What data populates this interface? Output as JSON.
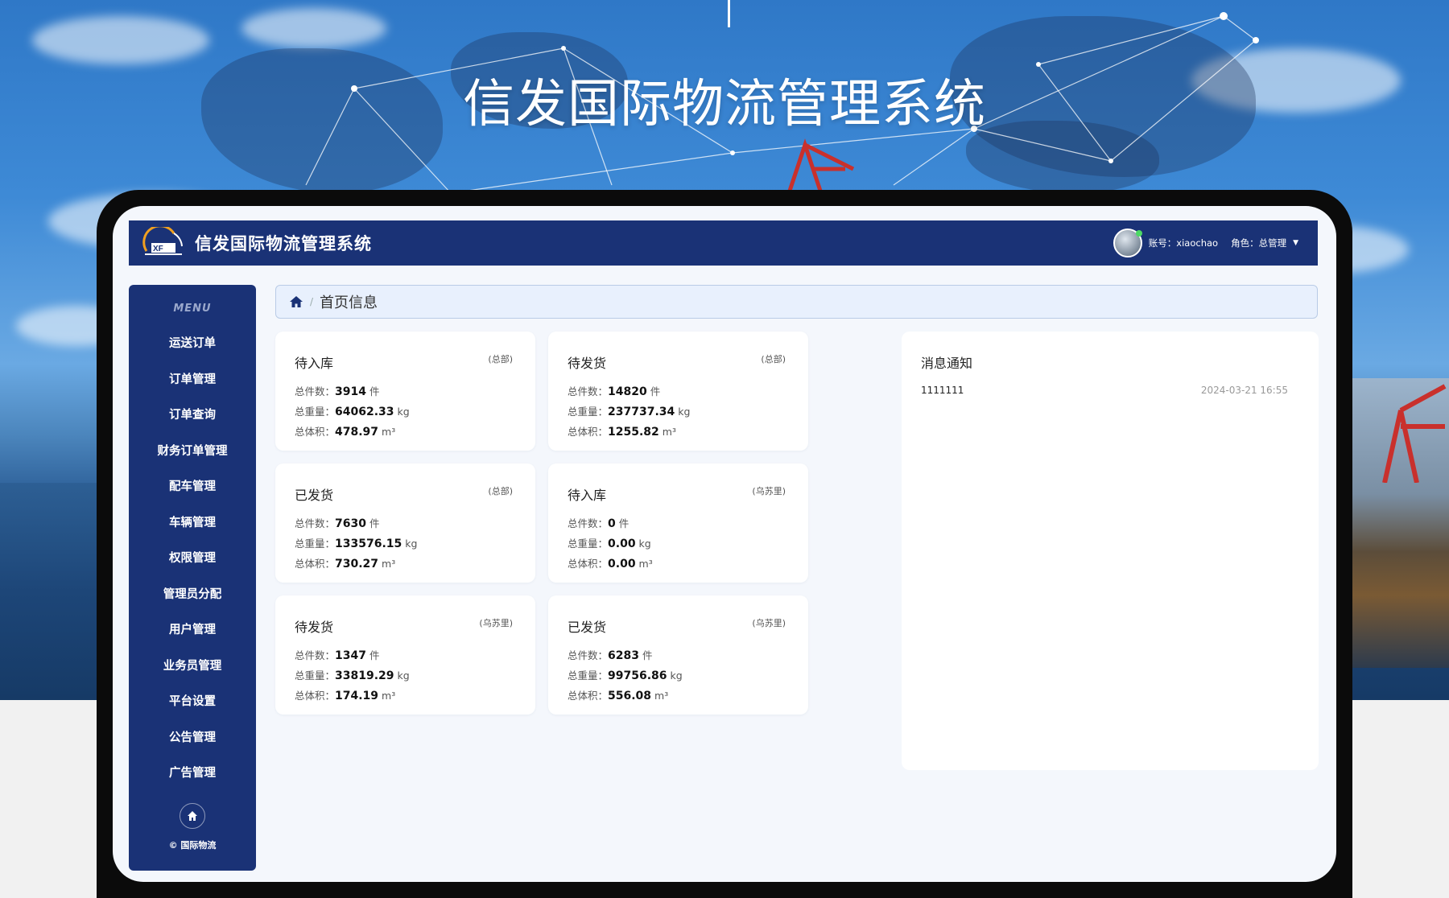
{
  "hero": {
    "title": "信发国际物流管理系统"
  },
  "header": {
    "app_name": "信发国际物流管理系统",
    "account_label": "账号：",
    "account": "xiaochao",
    "role_label": "角色：",
    "role": "总管理"
  },
  "sidebar": {
    "menu_title": "MENU",
    "items": [
      {
        "label": "运送订单"
      },
      {
        "label": "订单管理"
      },
      {
        "label": "订单查询"
      },
      {
        "label": "财务订单管理"
      },
      {
        "label": "配车管理"
      },
      {
        "label": "车辆管理"
      },
      {
        "label": "权限管理"
      },
      {
        "label": "管理员分配"
      },
      {
        "label": "用户管理"
      },
      {
        "label": "业务员管理"
      },
      {
        "label": "平台设置"
      },
      {
        "label": "公告管理"
      },
      {
        "label": "广告管理"
      }
    ],
    "copyright": "© 国际物流"
  },
  "breadcrumb": {
    "current": "首页信息"
  },
  "labels": {
    "count": "总件数：",
    "weight": "总重量：",
    "volume": "总体积：",
    "piece": "件",
    "kg": "kg",
    "m3": "m³"
  },
  "cards": [
    {
      "title": "待入库",
      "tag": "(总部)",
      "count": "3914",
      "weight": "64062.33",
      "volume": "478.97"
    },
    {
      "title": "待发货",
      "tag": "(总部)",
      "count": "14820",
      "weight": "237737.34",
      "volume": "1255.82"
    },
    {
      "title": "已发货",
      "tag": "(总部)",
      "count": "7630",
      "weight": "133576.15",
      "volume": "730.27"
    },
    {
      "title": "待入库",
      "tag": "(乌苏里)",
      "count": "0",
      "weight": "0.00",
      "volume": "0.00"
    },
    {
      "title": "待发货",
      "tag": "(乌苏里)",
      "count": "1347",
      "weight": "33819.29",
      "volume": "174.19"
    },
    {
      "title": "已发货",
      "tag": "(乌苏里)",
      "count": "6283",
      "weight": "99756.86",
      "volume": "556.08"
    }
  ],
  "notice": {
    "title": "消息通知",
    "items": [
      {
        "text": "1111111",
        "date": "2024-03-21 16:55"
      }
    ]
  },
  "colors": {
    "primary": "#1a3276",
    "card_bg": "#ffffff",
    "page_bg": "#f4f7fc"
  }
}
